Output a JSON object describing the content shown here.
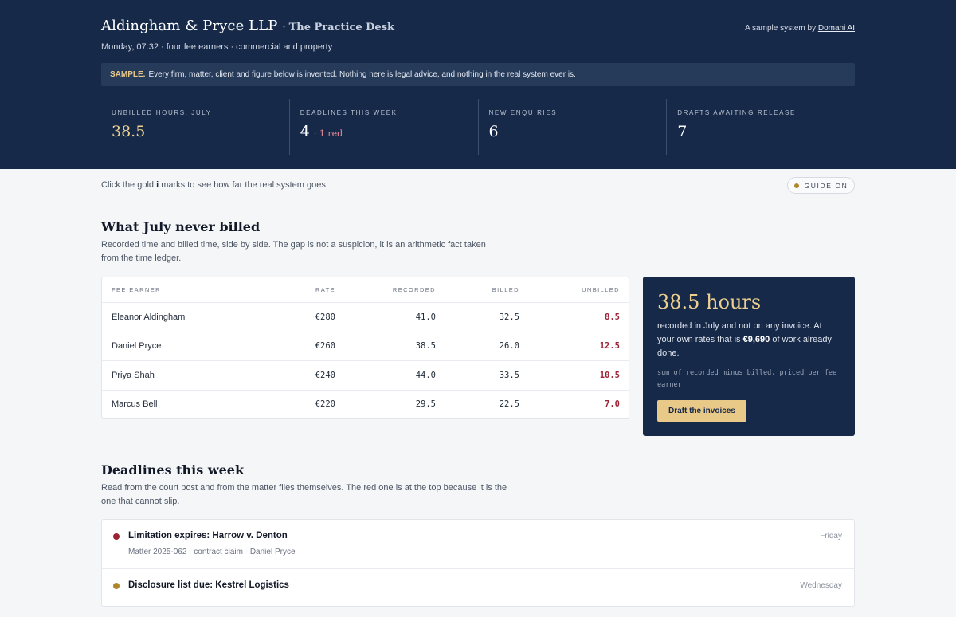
{
  "header": {
    "firm": "Aldingham & Pryce LLP",
    "separator": "·",
    "subtitle": "The Practice Desk",
    "meta": "Monday, 07:32 · four fee earners · commercial and property",
    "byline_prefix": "A sample system by",
    "byline_link": "Domani AI",
    "banner_tag": "SAMPLE.",
    "banner_text": "Every firm, matter, client and figure below is invented. Nothing here is legal advice, and nothing in the real system ever is."
  },
  "stats": [
    {
      "label": "UNBILLED HOURS, JULY",
      "value": "38.5",
      "note": ""
    },
    {
      "label": "DEADLINES THIS WEEK",
      "value": "4",
      "note": "· 1 red"
    },
    {
      "label": "NEW ENQUIRIES",
      "value": "6",
      "note": ""
    },
    {
      "label": "DRAFTS AWAITING RELEASE",
      "value": "7",
      "note": ""
    }
  ],
  "guide": {
    "text_before": "Click the gold",
    "text_mark": "i",
    "text_after": "marks to see how far the real system goes.",
    "pill_label": "GUIDE ON"
  },
  "unbilled_section": {
    "title": "What July never billed",
    "desc": "Recorded time and billed time, side by side. The gap is not a suspicion, it is an arithmetic fact taken from the time ledger.",
    "columns": [
      "FEE EARNER",
      "RATE",
      "RECORDED",
      "BILLED",
      "UNBILLED"
    ],
    "rows": [
      {
        "name": "Eleanor Aldingham",
        "rate": "€280",
        "recorded": "41.0",
        "billed": "32.5",
        "unbilled": "8.5"
      },
      {
        "name": "Daniel Pryce",
        "rate": "€260",
        "recorded": "38.5",
        "billed": "26.0",
        "unbilled": "12.5"
      },
      {
        "name": "Priya Shah",
        "rate": "€240",
        "recorded": "44.0",
        "billed": "33.5",
        "unbilled": "10.5"
      },
      {
        "name": "Marcus Bell",
        "rate": "€220",
        "recorded": "29.5",
        "billed": "22.5",
        "unbilled": "7.0"
      }
    ]
  },
  "summary": {
    "big": "38.5 hours",
    "text_before": "recorded in July and not on any invoice. At your own rates that is",
    "amount": "€9,690",
    "text_after": "of work already done.",
    "note": "sum of recorded minus billed, priced per fee earner",
    "button": "Draft the invoices"
  },
  "deadlines_section": {
    "title": "Deadlines this week",
    "desc": "Read from the court post and from the matter files themselves. The red one is at the top because it is the one that cannot slip.",
    "items": [
      {
        "title": "Limitation expires: Harrow v. Denton",
        "meta": "Matter 2025-062 · contract claim · Daniel Pryce",
        "day": "Friday",
        "color": "#9b2335"
      },
      {
        "title": "Disclosure list due: Kestrel Logistics",
        "meta": "",
        "day": "Wednesday",
        "color": "#b0862b"
      }
    ]
  },
  "colors": {
    "navy": "#172949",
    "gold": "#ecd08f",
    "red": "#9b2335",
    "amber": "#b0862b"
  }
}
